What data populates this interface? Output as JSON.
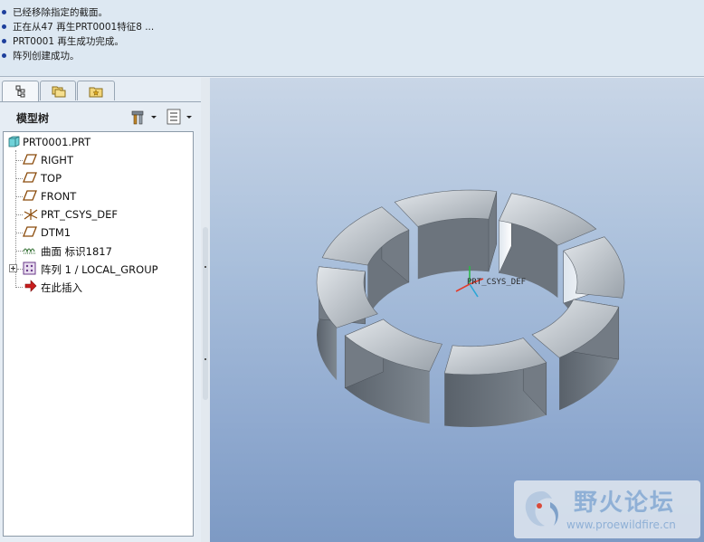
{
  "messages": [
    "已经移除指定的截面。",
    "正在从47 再生PRT0001特征8 ...",
    "PRT0001 再生成功完成。",
    "阵列创建成功。"
  ],
  "navigator": {
    "tabs": [
      "model-tree",
      "folder-browser",
      "favorites"
    ],
    "title": "模型树"
  },
  "tree": {
    "root": "PRT0001.PRT",
    "items": [
      {
        "label": "RIGHT",
        "icon": "datum-plane-icon"
      },
      {
        "label": "TOP",
        "icon": "datum-plane-icon"
      },
      {
        "label": "FRONT",
        "icon": "datum-plane-icon"
      },
      {
        "label": "PRT_CSYS_DEF",
        "icon": "csys-icon"
      },
      {
        "label": "DTM1",
        "icon": "datum-plane-icon"
      },
      {
        "label": "曲面 标识1817",
        "icon": "surface-icon"
      },
      {
        "label": "阵列 1 / LOCAL_GROUP",
        "icon": "pattern-icon"
      },
      {
        "label": "在此插入",
        "icon": "insert-arrow-icon"
      }
    ]
  },
  "viewport": {
    "csys_label": "PRT_CSYS_DEF",
    "segment_count": 8,
    "body_color": "#6f7780"
  },
  "watermark": {
    "brand": "野火论坛",
    "url": "www.proewildfire.cn"
  }
}
